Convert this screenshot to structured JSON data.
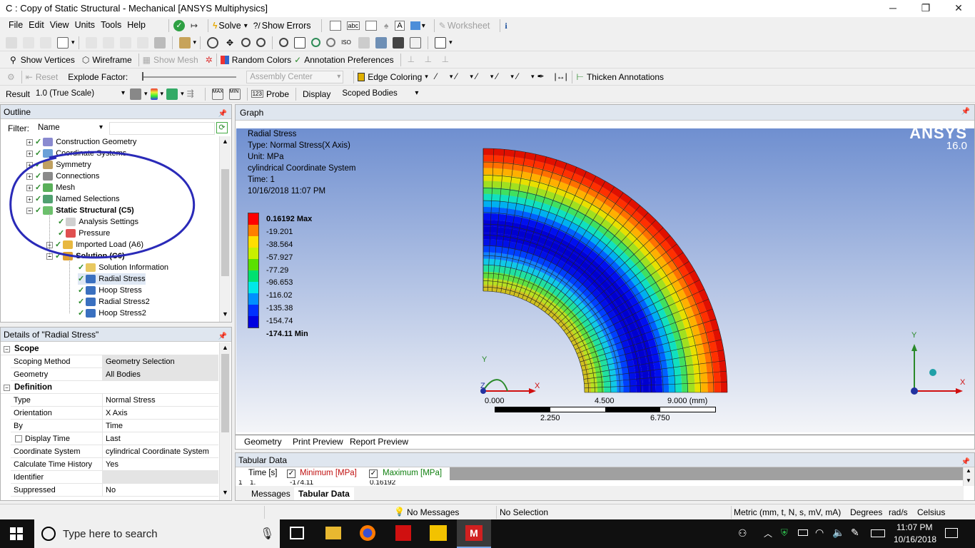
{
  "window": {
    "title": "C : Copy of Static Structural - Mechanical [ANSYS Multiphysics]"
  },
  "menu": [
    "File",
    "Edit",
    "View",
    "Units",
    "Tools",
    "Help"
  ],
  "toolbar1": {
    "solve": "Solve",
    "show_errors": "Show Errors",
    "worksheet": "Worksheet"
  },
  "toolbar3": {
    "show_vertices": "Show Vertices",
    "wireframe": "Wireframe",
    "show_mesh": "Show Mesh",
    "random_colors": "Random Colors",
    "annotation_prefs": "Annotation Preferences"
  },
  "toolbar4": {
    "reset": "Reset",
    "explode_factor": "Explode Factor:",
    "assembly_center": "Assembly Center",
    "edge_coloring": "Edge Coloring",
    "thicken_annotations": "Thicken Annotations"
  },
  "toolbar5": {
    "result_label": "Result",
    "scale": "1.0 (True Scale)",
    "probe": "Probe",
    "display_label": "Display",
    "display_value": "Scoped Bodies"
  },
  "outline": {
    "title": "Outline",
    "filter_label": "Filter:",
    "filter_value": "Name",
    "items": [
      {
        "label": "Construction Geometry",
        "bold": false
      },
      {
        "label": "Coordinate Systems",
        "bold": false
      },
      {
        "label": "Symmetry",
        "bold": false
      },
      {
        "label": "Connections",
        "bold": false
      },
      {
        "label": "Mesh",
        "bold": false
      },
      {
        "label": "Named Selections",
        "bold": false
      },
      {
        "label": "Static Structural (C5)",
        "bold": true
      },
      {
        "label": "Analysis Settings",
        "bold": false
      },
      {
        "label": "Pressure",
        "bold": false
      },
      {
        "label": "Imported Load (A6)",
        "bold": false
      },
      {
        "label": "Solution (C6)",
        "bold": true
      },
      {
        "label": "Solution Information",
        "bold": false
      },
      {
        "label": "Radial Stress",
        "bold": false
      },
      {
        "label": "Hoop Stress",
        "bold": false
      },
      {
        "label": "Radial Stress2",
        "bold": false
      },
      {
        "label": "Hoop Stress2",
        "bold": false
      }
    ]
  },
  "details": {
    "title": "Details of \"Radial Stress\"",
    "groups": {
      "scope": "Scope",
      "definition": "Definition"
    },
    "rows": {
      "scoping_method": [
        "Scoping Method",
        "Geometry Selection"
      ],
      "geometry": [
        "Geometry",
        "All Bodies"
      ],
      "type": [
        "Type",
        "Normal Stress"
      ],
      "orientation": [
        "Orientation",
        "X Axis"
      ],
      "by": [
        "By",
        "Time"
      ],
      "display_time": [
        "Display Time",
        "Last"
      ],
      "coord_system": [
        "Coordinate System",
        "cylindrical Coordinate System"
      ],
      "calc_time_history": [
        "Calculate Time History",
        "Yes"
      ],
      "identifier": [
        "Identifier",
        ""
      ],
      "suppressed": [
        "Suppressed",
        "No"
      ]
    }
  },
  "graph": {
    "title": "Graph",
    "info": {
      "name": "Radial Stress",
      "type": "Type: Normal Stress(X Axis)",
      "unit": "Unit: MPa",
      "cs": "cylindrical Coordinate System",
      "time": "Time: 1",
      "date": "10/16/2018 11:07 PM"
    },
    "logo": {
      "brand": "ANSYS",
      "version": "16.0"
    },
    "legend": {
      "max": "0.16192 Max",
      "values": [
        "-19.201",
        "-38.564",
        "-57.927",
        "-77.29",
        "-96.653",
        "-116.02",
        "-135.38",
        "-154.74"
      ],
      "min": "-174.11 Min",
      "colors": [
        "#ff0000",
        "#ff7f00",
        "#ffdf00",
        "#c8f000",
        "#5ae000",
        "#00e070",
        "#00e8e8",
        "#0090ff",
        "#0030ff",
        "#0000e0"
      ]
    },
    "scale": {
      "t0": "0.000",
      "t1": "4.500",
      "t2": "9.000 (mm)",
      "m1": "2.250",
      "m2": "6.750"
    },
    "axes": {
      "x": "X",
      "y": "Y",
      "z": "Z"
    },
    "tabs": [
      "Geometry",
      "Print Preview",
      "Report Preview"
    ]
  },
  "tabular": {
    "title": "Tabular Data",
    "columns": [
      "Time [s]",
      "Minimum [MPa]",
      "Maximum [MPa]"
    ],
    "row": [
      "1",
      "1.",
      "-174.11",
      "0.16192"
    ],
    "tabs": [
      "Messages",
      "Tabular Data"
    ]
  },
  "status": {
    "messages": "No Messages",
    "selection": "No Selection",
    "units": "Metric (mm, t, N, s, mV, mA)",
    "degrees": "Degrees",
    "rads": "rad/s",
    "celsius": "Celsius"
  },
  "taskbar": {
    "search": "Type here to search",
    "time": "11:07 PM",
    "date": "10/16/2018"
  }
}
